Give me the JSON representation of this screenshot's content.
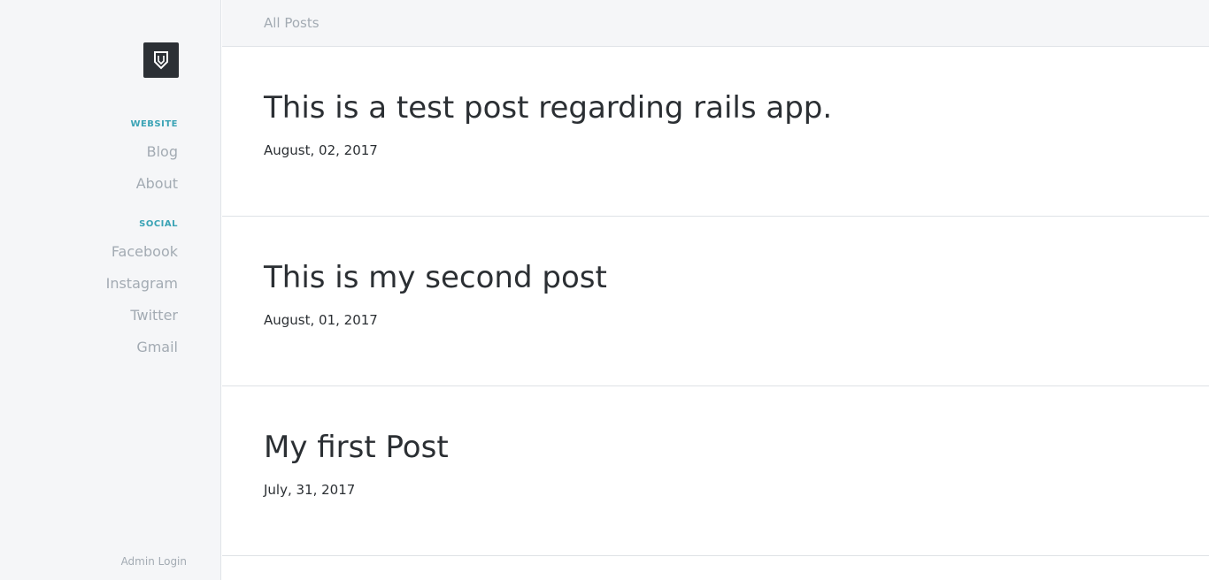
{
  "sidebar": {
    "logo_icon": "shield-logo-icon",
    "sections": [
      {
        "title": "WEBSITE",
        "links": [
          "Blog",
          "About"
        ]
      },
      {
        "title": "SOCIAL",
        "links": [
          "Facebook",
          "Instagram",
          "Twitter",
          "Gmail"
        ]
      }
    ],
    "admin_login": "Admin Login"
  },
  "header": {
    "breadcrumb": "All Posts"
  },
  "posts": [
    {
      "title": "This is a test post regarding rails app.",
      "date": "August, 02, 2017"
    },
    {
      "title": "This is my second post",
      "date": "August, 01, 2017"
    },
    {
      "title": "My first Post",
      "date": "July, 31, 2017"
    }
  ],
  "colors": {
    "accent": "#3aa3b5",
    "muted_text": "#a3abb3",
    "sidebar_bg": "#f5f6f8",
    "logo_bg": "#2c3035"
  }
}
